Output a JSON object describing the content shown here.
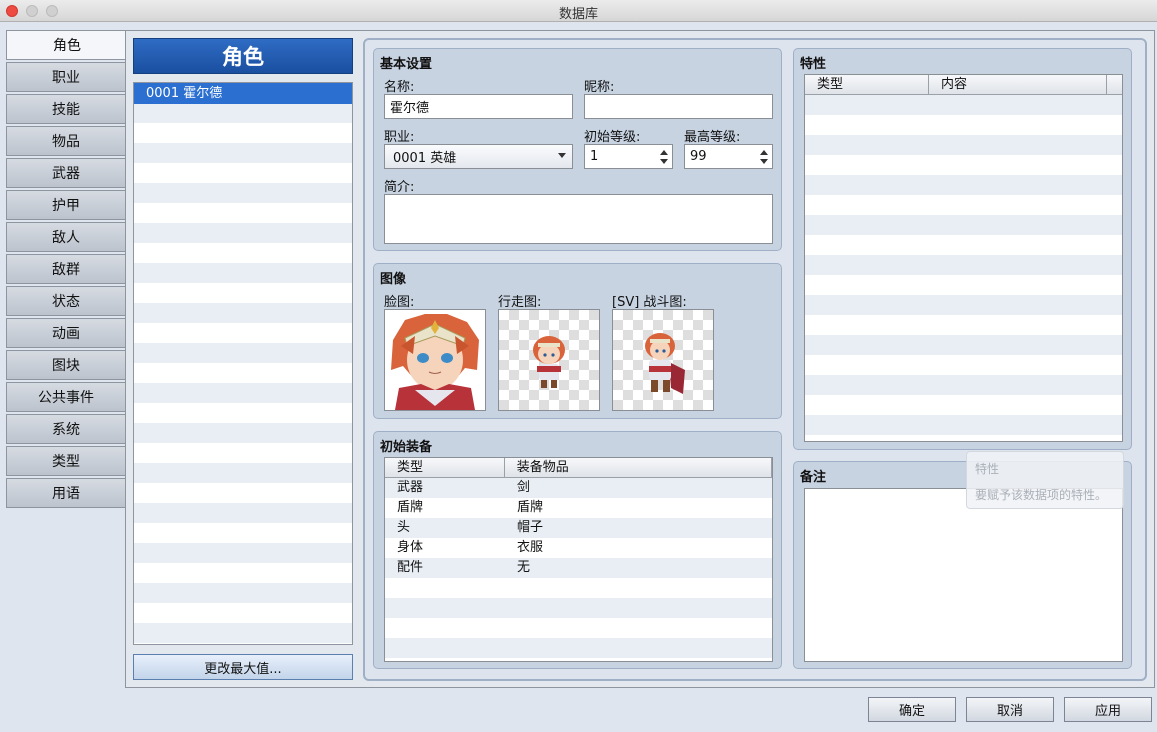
{
  "window": {
    "title": "数据库"
  },
  "tabs": [
    "角色",
    "职业",
    "技能",
    "物品",
    "武器",
    "护甲",
    "敌人",
    "敌群",
    "状态",
    "动画",
    "图块",
    "公共事件",
    "系统",
    "类型",
    "用语"
  ],
  "actor_list": {
    "header": "角色",
    "items": [
      "0001 霍尔德"
    ],
    "change_max_button": "更改最大值..."
  },
  "general": {
    "title": "基本设置",
    "name_label": "名称:",
    "name_value": "霍尔德",
    "nickname_label": "昵称:",
    "nickname_value": "",
    "class_label": "职业:",
    "class_value": "0001 英雄",
    "initial_level_label": "初始等级:",
    "initial_level_value": "1",
    "max_level_label": "最高等级:",
    "max_level_value": "99",
    "profile_label": "简介:",
    "profile_value": ""
  },
  "images": {
    "title": "图像",
    "face_label": "脸图:",
    "walk_label": "行走图:",
    "battler_label": "[SV] 战斗图:"
  },
  "equipment": {
    "title": "初始装备",
    "columns": [
      "类型",
      "装备物品"
    ],
    "rows": [
      {
        "type": "武器",
        "item": "剑"
      },
      {
        "type": "盾牌",
        "item": "盾牌"
      },
      {
        "type": "头",
        "item": "帽子"
      },
      {
        "type": "身体",
        "item": "衣服"
      },
      {
        "type": "配件",
        "item": "无"
      }
    ]
  },
  "traits": {
    "title": "特性",
    "columns": [
      "类型",
      "内容"
    ]
  },
  "note": {
    "title": "备注",
    "value": ""
  },
  "tooltip": {
    "title": "特性",
    "text": "要赋予该数据项的特性。"
  },
  "buttons": {
    "ok": "确定",
    "cancel": "取消",
    "apply": "应用"
  },
  "colors": {
    "selection": "#2b6fd1",
    "header": "#1a4fa0",
    "panel": "#c8d3e2"
  }
}
